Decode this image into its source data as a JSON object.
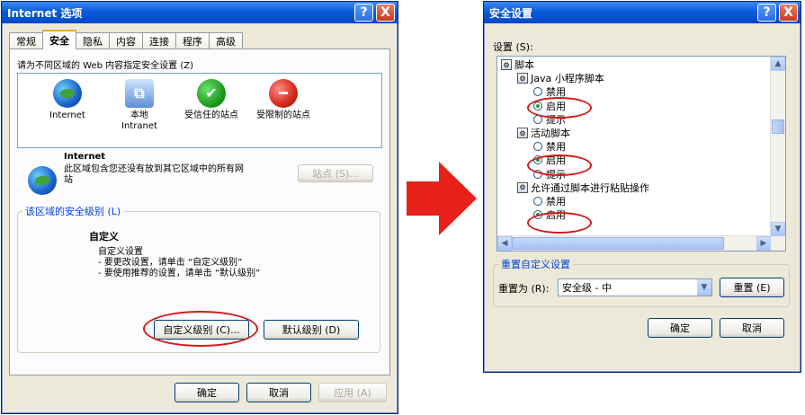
{
  "left_dialog": {
    "title": "Internet 选项",
    "help_label": "?",
    "close_label": "X",
    "tabs": [
      "常规",
      "安全",
      "隐私",
      "内容",
      "连接",
      "程序",
      "高级"
    ],
    "zone_prompt": "请为不同区域的 Web 内容指定安全设置 (Z)",
    "zones": [
      {
        "label": "Internet",
        "icon": "globe-icon"
      },
      {
        "label": "本地\nIntranet",
        "icon": "computer-network-icon"
      },
      {
        "label": "受信任的站点",
        "icon": "checkmark-icon"
      },
      {
        "label": "受限制的站点",
        "icon": "restricted-icon"
      }
    ],
    "selected_zone": {
      "name": "Internet",
      "description": "此区域包含您还没有放到其它区域中的所有网站"
    },
    "sites_button": "站点 (S)...",
    "security_level_label": "该区域的安全级别 (L)",
    "custom_title": "自定义",
    "custom_line1": "自定义设置",
    "custom_line2": "- 要更改设置，请单击 “自定义级别”",
    "custom_line3": "- 要使用推荐的设置，请单击 “默认级别”",
    "custom_level_button": "自定义级别 (C)...",
    "default_level_button": "默认级别 (D)",
    "ok_button": "确定",
    "cancel_button": "取消",
    "apply_button": "应用 (A)"
  },
  "right_dialog": {
    "title": "安全设置",
    "help_label": "?",
    "close_label": "X",
    "settings_label": "设置 (S):",
    "tree": [
      {
        "type": "folder",
        "label": "脚本",
        "indent": 0
      },
      {
        "type": "folder",
        "label": "Java 小程序脚本",
        "indent": 1
      },
      {
        "type": "radio",
        "label": "禁用",
        "checked": false,
        "indent": 2
      },
      {
        "type": "radio",
        "label": "启用",
        "checked": true,
        "indent": 2
      },
      {
        "type": "radio",
        "label": "提示",
        "checked": false,
        "indent": 2
      },
      {
        "type": "folder",
        "label": "活动脚本",
        "indent": 1
      },
      {
        "type": "radio",
        "label": "禁用",
        "checked": false,
        "indent": 2
      },
      {
        "type": "radio",
        "label": "启用",
        "checked": true,
        "indent": 2
      },
      {
        "type": "radio",
        "label": "提示",
        "checked": false,
        "indent": 2
      },
      {
        "type": "folder",
        "label": "允许通过脚本进行粘贴操作",
        "indent": 1
      },
      {
        "type": "radio",
        "label": "禁用",
        "checked": false,
        "indent": 2
      },
      {
        "type": "radio",
        "label": "启用",
        "checked": true,
        "indent": 2
      }
    ],
    "reset_group_label": "重置自定义设置",
    "reset_to_label": "重置为 (R):",
    "reset_select_value": "安全级 - 中",
    "reset_button": "重置 (E)",
    "ok_button": "确定",
    "cancel_button": "取消"
  },
  "arrow_color": "#e8201a"
}
